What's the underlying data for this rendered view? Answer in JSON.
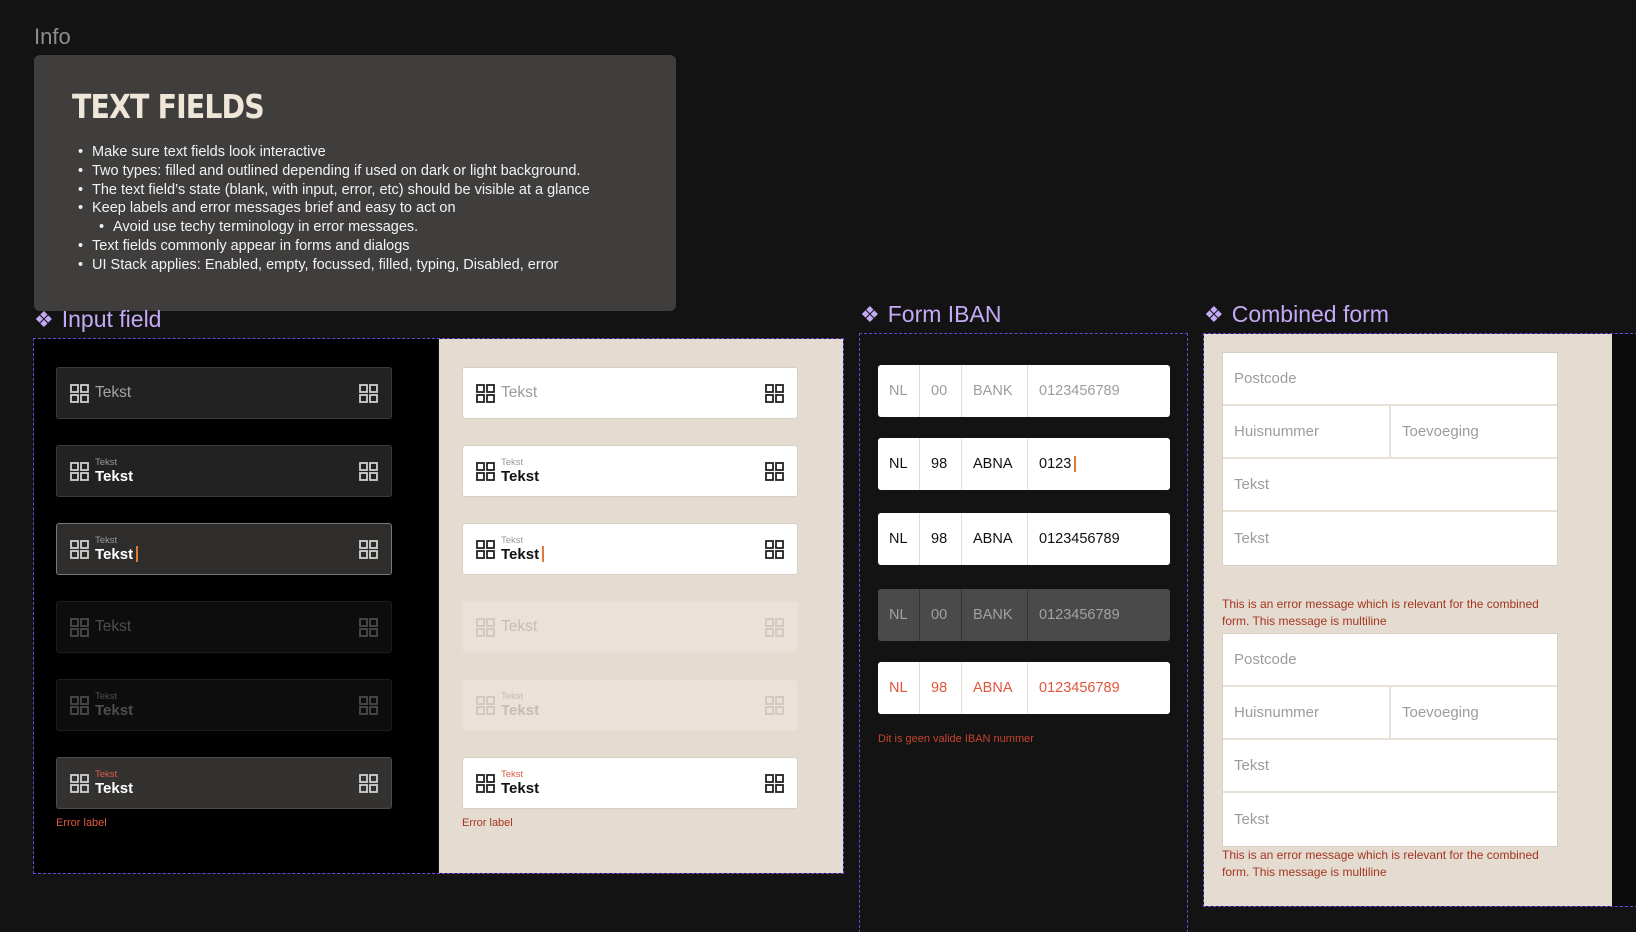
{
  "info": {
    "label": "Info",
    "title": "TEXT FIELDS",
    "bullets": [
      "Make sure text fields look interactive",
      "Two types: filled and outlined depending if used on dark or light background.",
      "The text field’s state (blank, with input, error, etc) should be visible at a glance",
      "Keep labels and error messages brief and easy to act on",
      "Avoid use techy terminology in error messages.",
      "Text fields commonly appear in forms and dialogs",
      "UI Stack applies: Enabled, empty, focussed, filled, typing, Disabled, error"
    ]
  },
  "sections": {
    "input_field": "Input field",
    "form_iban": "Form IBAN",
    "combined_form": "Combined form"
  },
  "input_field": {
    "dark": [
      {
        "state": "empty",
        "placeholder": "Tekst"
      },
      {
        "state": "filled",
        "label": "Tekst",
        "value": "Tekst"
      },
      {
        "state": "typing",
        "label": "Tekst",
        "value": "Tekst"
      },
      {
        "state": "disabled-empty",
        "placeholder": "Tekst"
      },
      {
        "state": "disabled-filled",
        "label": "Tekst",
        "value": "Tekst"
      },
      {
        "state": "error",
        "label": "Tekst",
        "value": "Tekst"
      }
    ],
    "light": [
      {
        "state": "empty",
        "placeholder": "Tekst"
      },
      {
        "state": "filled",
        "label": "Tekst",
        "value": "Tekst"
      },
      {
        "state": "typing",
        "label": "Tekst",
        "value": "Tekst"
      },
      {
        "state": "disabled-empty",
        "placeholder": "Tekst"
      },
      {
        "state": "disabled-filled",
        "label": "Tekst",
        "value": "Tekst"
      },
      {
        "state": "error",
        "label": "Tekst",
        "value": "Tekst"
      }
    ],
    "error_label": "Error label"
  },
  "iban": {
    "rows": [
      {
        "state": "empty",
        "country": "NL",
        "check": "00",
        "bank": "BANK",
        "account": "0123456789"
      },
      {
        "state": "typing",
        "country": "NL",
        "check": "98",
        "bank": "ABNA",
        "account": "0123"
      },
      {
        "state": "filled",
        "country": "NL",
        "check": "98",
        "bank": "ABNA",
        "account": "0123456789"
      },
      {
        "state": "disabled",
        "country": "NL",
        "check": "00",
        "bank": "BANK",
        "account": "0123456789"
      },
      {
        "state": "error",
        "country": "NL",
        "check": "98",
        "bank": "ABNA",
        "account": "0123456789"
      }
    ],
    "error_message": "Dit is geen valide IBAN nummer"
  },
  "combined": {
    "form1": {
      "postcode": "Postcode",
      "huisnummer": "Huisnummer",
      "toevoeging": "Toevoeging",
      "field3": "Tekst",
      "field4": "Tekst"
    },
    "error1": "This is an error message which is relevant for the combined form. This message is multiline",
    "form2": {
      "postcode": "Postcode",
      "huisnummer": "Huisnummer",
      "toevoeging": "Toevoeging",
      "field3": "Tekst",
      "field4": "Tekst"
    },
    "error2": "This is an error message which is relevant for the combined form. This message is multiline"
  },
  "colors": {
    "background": "#131313",
    "accent_purple": "#c4a9f5",
    "frame_dashed": "#6e44d4",
    "light_panel": "#e4dbd1",
    "error_red": "#e05a44",
    "caret_orange": "#e07a3c"
  },
  "icons": {
    "field_leading": "grid-icon",
    "field_trailing": "grid-icon",
    "section_marker": "component-diamond-icon"
  }
}
